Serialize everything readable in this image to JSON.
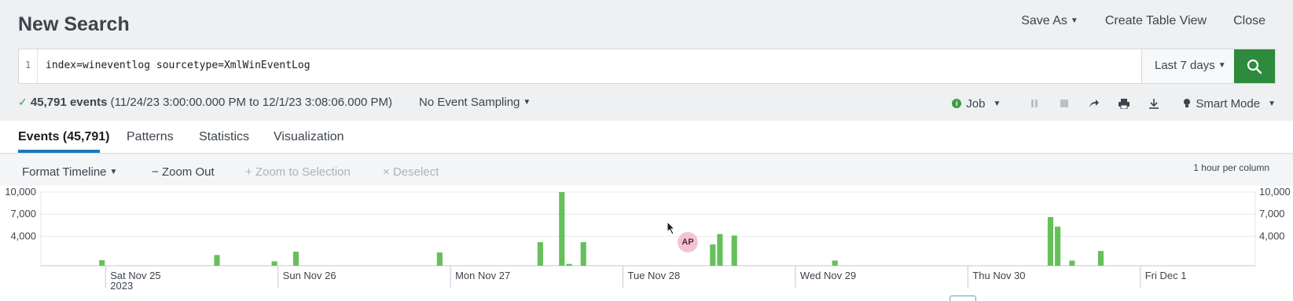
{
  "page": {
    "title": "New Search"
  },
  "top_actions": {
    "save_as": "Save As",
    "create_table_view": "Create Table View",
    "close": "Close"
  },
  "search": {
    "line_number": "1",
    "query": "index=wineventlog sourcetype=XmlWinEventLog",
    "time_range": "Last 7 days"
  },
  "status": {
    "events_count": "45,791 events",
    "range": "(11/24/23 3:00:00.000 PM to 12/1/23 3:08:06.000 PM)",
    "sampling": "No Event Sampling",
    "job": "Job",
    "mode": "Smart Mode"
  },
  "tabs": [
    {
      "label": "Events (45,791)",
      "active": true
    },
    {
      "label": "Patterns",
      "active": false
    },
    {
      "label": "Statistics",
      "active": false
    },
    {
      "label": "Visualization",
      "active": false
    }
  ],
  "timeline": {
    "format_timeline": "Format Timeline",
    "zoom_out": "Zoom Out",
    "zoom_to_selection": "Zoom to Selection",
    "deselect": "Deselect",
    "per_column": "1 hour per column"
  },
  "avatar": {
    "initials": "AP"
  },
  "colors": {
    "accent": "#1a78b8",
    "search_button": "#2e8a3c",
    "bar": "#65c05a"
  },
  "chart_data": {
    "type": "bar",
    "y_ticks": [
      "10,000",
      "7,000",
      "4,000"
    ],
    "y_tick_values": [
      10000,
      7000,
      4000
    ],
    "ylim": [
      0,
      10000
    ],
    "x_start": "2023-11-24T15:00",
    "x_end": "2023-12-01T16:00",
    "x_labels": [
      {
        "day": "Sat Nov 25",
        "year": "2023",
        "time": "2023-11-25T00:00"
      },
      {
        "day": "Sun Nov 26",
        "time": "2023-11-26T00:00"
      },
      {
        "day": "Mon Nov 27",
        "time": "2023-11-27T00:00"
      },
      {
        "day": "Tue Nov 28",
        "time": "2023-11-28T00:00"
      },
      {
        "day": "Wed Nov 29",
        "time": "2023-11-29T00:00"
      },
      {
        "day": "Thu Nov 30",
        "time": "2023-11-30T00:00"
      },
      {
        "day": "Fri Dec 1",
        "time": "2023-12-01T00:00"
      }
    ],
    "points": [
      {
        "time": "2023-11-24T23:00",
        "value": 750
      },
      {
        "time": "2023-11-25T15:00",
        "value": 1450
      },
      {
        "time": "2023-11-25T23:00",
        "value": 600
      },
      {
        "time": "2023-11-26T02:00",
        "value": 1900
      },
      {
        "time": "2023-11-26T22:00",
        "value": 1800
      },
      {
        "time": "2023-11-27T12:00",
        "value": 3200
      },
      {
        "time": "2023-11-27T15:00",
        "value": 10000
      },
      {
        "time": "2023-11-27T16:00",
        "value": 250
      },
      {
        "time": "2023-11-27T18:00",
        "value": 3200
      },
      {
        "time": "2023-11-28T12:00",
        "value": 2900
      },
      {
        "time": "2023-11-28T13:00",
        "value": 4300
      },
      {
        "time": "2023-11-28T15:00",
        "value": 4100
      },
      {
        "time": "2023-11-29T05:00",
        "value": 700
      },
      {
        "time": "2023-11-30T11:00",
        "value": 6600
      },
      {
        "time": "2023-11-30T12:00",
        "value": 5300
      },
      {
        "time": "2023-11-30T14:00",
        "value": 700
      },
      {
        "time": "2023-11-30T18:00",
        "value": 2000
      }
    ]
  }
}
